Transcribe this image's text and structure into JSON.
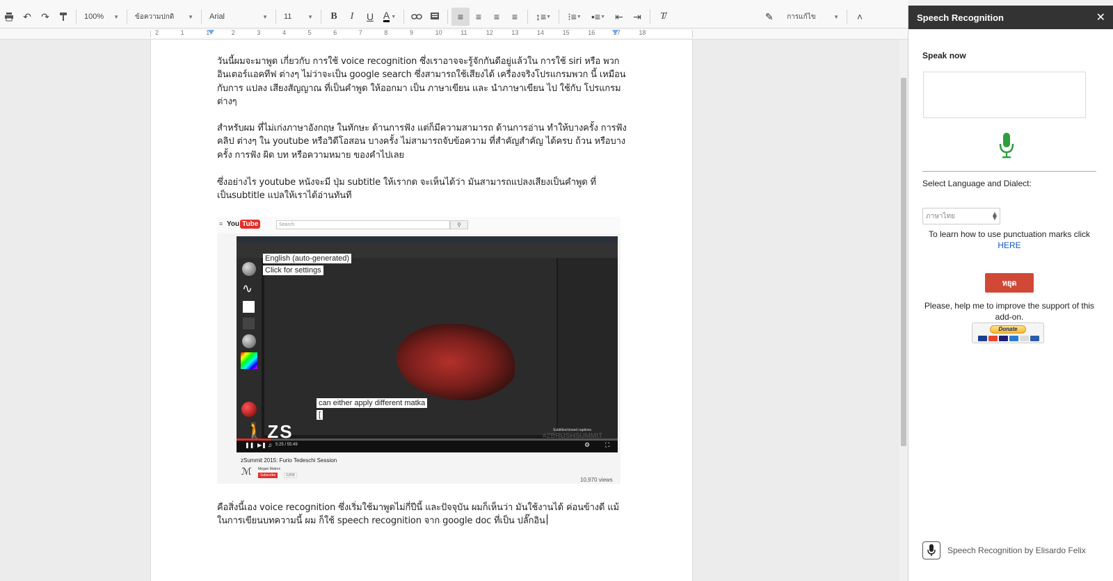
{
  "toolbar": {
    "zoom": "100%",
    "style": "ข้อความปกติ",
    "font": "Arial",
    "size": "11",
    "mode": "การแก้ไข"
  },
  "ruler": {
    "ticks": [
      "2",
      "1",
      "1",
      "2",
      "3",
      "4",
      "5",
      "6",
      "7",
      "8",
      "9",
      "10",
      "11",
      "12",
      "13",
      "14",
      "15",
      "16",
      "17",
      "18"
    ]
  },
  "document": {
    "para1": "วันนี้ผมจะมาพูด เกี่ยวกับ การใช้ voice recognition ซึ่งเราอาจจะรู้จักกันดีอยู่แล้วใน การใช้ siri หรือ พวกอินเตอร์แอคทีฟ ต่างๆ ไม่ว่าจะเป็น google search ซึ่งสามารถใช้เสียงได้ เครื่องจริงโปรแกรมพวก นี้ เหมือนกับการ แปลง เสียงสัญญาณ ที่เป็นคำพูด ให้ออกมา เป็น ภาษาเขียน และ นำภาษาเขียน ไป ใช้กับ โปรแกรมต่างๆ",
    "para2": "สำหรับผม ที่ไม่เก่งภาษาอังกฤษ ในทักษะ ด้านการฟัง แต่ก็มีความสามารถ ด้านการอ่าน ทำให้บางครั้ง การฟังคลิป ต่างๆ ใน youtube หรือวิดีโอสอน บางครั้ง ไม่สามารถจับข้อความ ที่สำคัญสำคัญ ได้ครบ ถ้วน หรือบางครั้ง การฟัง ผิด บท หรือความหมาย ของคำไปเลย",
    "para3": "ซึ่งอย่างไร youtube หนังจะมี ปุ่ม subtitle ให้เรากด จะเห็นได้ว่า มันสามารถแปลงเสียงเป็นคำพูด ที่ เป็นsubtitle แปลให้เราได้อ่านทันที",
    "para4": "คือสิ่งนี้เอง voice recognition ซึ่งเริ่มใช้มาพูดไม่กี่ปีนี้ และปัจจุบัน ผมก็เห็นว่า มันใช้งานได้ ค่อนข้างดี แม้ในการเขียนบทความนี้ ผม ก็ใช้ speech recognition จาก google doc ที่เป็น ปลั๊กอิน"
  },
  "youtube": {
    "search_placeholder": "Search",
    "caption1": "English (auto-generated)",
    "caption2": "Click      for settings",
    "caption3": "can either apply different matka",
    "caption4": "[",
    "watermark": "#ZBRUSHSUMMIT",
    "subtitles_label": "Subtitles/closed captions",
    "time": "5:25 / 55:49",
    "progress": 0.09,
    "title": "zSummit 2015: Furio Tedeschi Session",
    "channel": "Megan Matrox",
    "subscribe": "Subscribe",
    "sub_count": "3,808",
    "views": "10,970 views"
  },
  "sidebar": {
    "title": "Speech Recognition",
    "speak_now": "Speak now",
    "select_label": "Select Language and Dialect:",
    "language": "ภาษาไทย",
    "punct_text": "To learn how to use punctuation marks click",
    "punct_link": "HERE",
    "stop_label": "หยุด",
    "help_text": "Please, help me to improve the support of this add-on.",
    "donate_label": "Donate",
    "footer": "Speech Recognition by Elisardo Felix",
    "mic_color": "#2e9e3c",
    "stop_color": "#d14836"
  }
}
